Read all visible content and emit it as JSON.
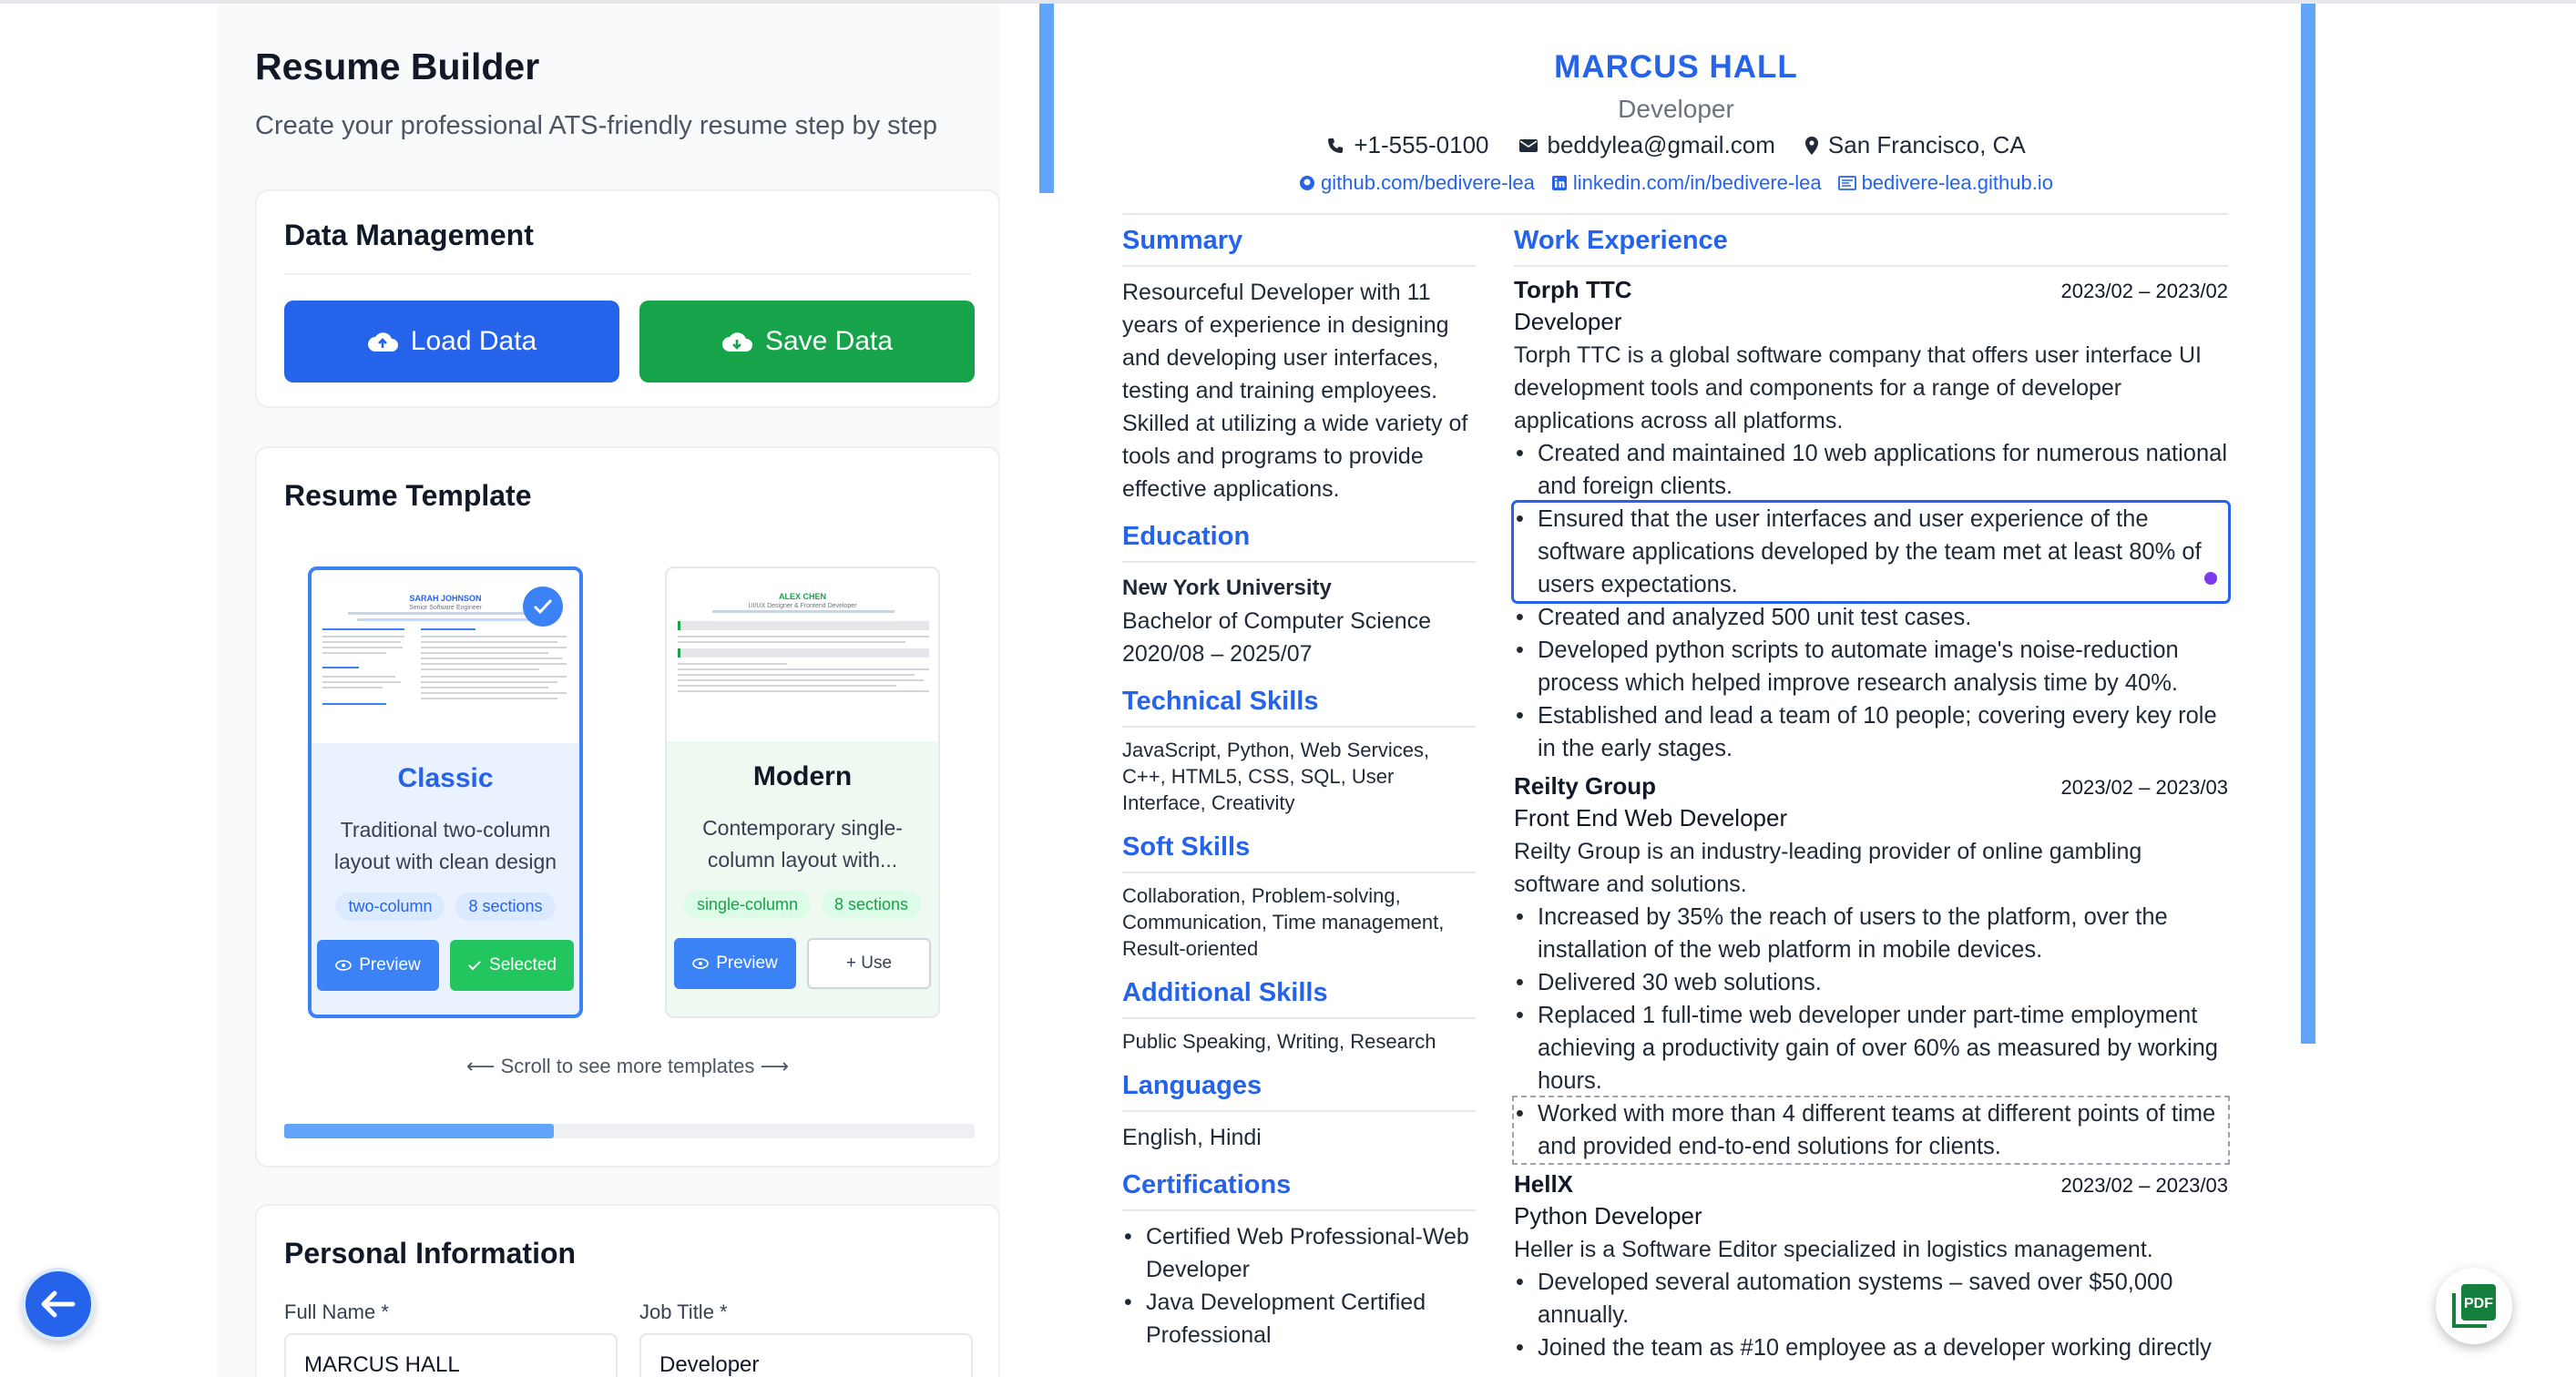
{
  "app": {
    "title": "Resume Builder",
    "subtitle": "Create your professional ATS-friendly resume step by step"
  },
  "data_management": {
    "title": "Data Management",
    "load_label": "Load Data",
    "save_label": "Save Data"
  },
  "template": {
    "title": "Resume Template",
    "scroll_hint": "⟵ Scroll to see more templates ⟶",
    "scroll_progress_percent": 39,
    "templates": [
      {
        "name": "Classic",
        "description": "Traditional two-column layout with clean design",
        "tags": [
          "two-column",
          "8 sections"
        ],
        "preview_label": "Preview",
        "action_label": "Selected",
        "selected": true,
        "thumb": {
          "name": "SARAH JOHNSON",
          "role": "Senior Software Engineer"
        }
      },
      {
        "name": "Modern",
        "description": "Contemporary single-column layout with...",
        "tags": [
          "single-column",
          "8 sections"
        ],
        "preview_label": "Preview",
        "action_label": "+ Use",
        "selected": false,
        "thumb": {
          "name": "ALEX CHEN",
          "role": "UI/UX Designer & Frontend Developer"
        }
      }
    ]
  },
  "personal_info": {
    "title": "Personal Information",
    "full_name_label": "Full Name *",
    "full_name_value": "MARCUS HALL",
    "job_title_label": "Job Title *",
    "job_title_value": "Developer"
  },
  "resume": {
    "name": "MARCUS HALL",
    "title": "Developer",
    "phone": "+1-555-0100",
    "email": "beddylea@gmail.com",
    "location": "San Francisco, CA",
    "github": "github.com/bedivere-lea",
    "linkedin": "linkedin.com/in/bedivere-lea",
    "website": "bedivere-lea.github.io",
    "headings": {
      "summary": "Summary",
      "education": "Education",
      "technical": "Technical Skills",
      "soft": "Soft Skills",
      "additional": "Additional Skills",
      "languages": "Languages",
      "certifications": "Certifications",
      "experience": "Work Experience"
    },
    "summary": "Resourceful Developer with 11 years of experience in designing and developing user interfaces, testing and training employees. Skilled at utilizing a wide variety of tools and programs to provide effective applications.",
    "education": {
      "school": "New York University",
      "degree": "Bachelor of Computer Science",
      "dates": "2020/08 – 2025/07"
    },
    "technical_skills": "JavaScript, Python, Web Services, C++, HTML5, CSS, SQL, User Interface, Creativity",
    "soft_skills": "Collaboration, Problem-solving, Communication, Time management, Result-oriented",
    "additional_skills": "Public Speaking, Writing, Research",
    "languages": "English, Hindi",
    "certifications": [
      "Certified Web Professional-Web Developer",
      "Java Development Certified Professional"
    ],
    "jobs": [
      {
        "company": "Torph TTC",
        "dates": "2023/02 – 2023/02",
        "role": "Developer",
        "description": "Torph TTC is a global software company that offers user interface UI development tools and components for a range of developer applications across all platforms.",
        "bullets": [
          "Created and maintained 10 web applications for numerous national and foreign clients.",
          "Ensured that the user interfaces and user experience of the software applications developed by the team met at least 80% of users expectations.",
          "Created and analyzed 500 unit test cases.",
          "Developed python scripts to automate image's noise-reduction process which helped improve research analysis time by 40%.",
          "Established and lead a team of 10 people; covering every key role in the early stages."
        ]
      },
      {
        "company": "Reilty Group",
        "dates": "2023/02 – 2023/03",
        "role": "Front End Web Developer",
        "description": "Reilty Group is an industry-leading provider of online gambling software and solutions.",
        "bullets": [
          "Increased by 35% the reach of users to the platform, over the installation of the web platform in mobile devices.",
          "Delivered 30 web solutions.",
          "Replaced 1 full-time web developer under part-time employment achieving a productivity gain of over 60% as measured by working hours.",
          "Worked with more than 4 different teams at different points of time and provided end-to-end solutions for clients."
        ]
      },
      {
        "company": "HellX",
        "dates": "2023/02 – 2023/03",
        "role": "Python Developer",
        "description": "Heller is a Software Editor specialized in logistics management.",
        "bullets": [
          "Developed several automation systems – saved over $50,000 annually.",
          "Joined the team as #10 employee as a developer working directly"
        ]
      }
    ]
  },
  "floating": {
    "pdf_label": "PDF"
  },
  "colors": {
    "primary": "#2563eb",
    "success": "#16a34a",
    "accent_bar": "#60a5fa"
  }
}
